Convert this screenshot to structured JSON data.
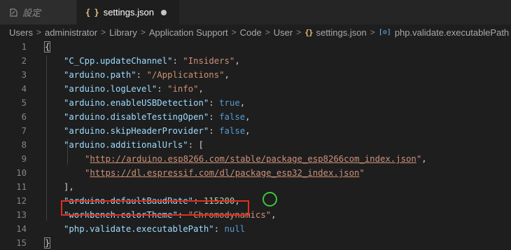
{
  "tabs": [
    {
      "label": "設定",
      "active": false
    },
    {
      "label": "settings.json",
      "active": true,
      "dirty": true
    }
  ],
  "breadcrumb": {
    "segments": [
      "Users",
      "administrator",
      "Library",
      "Application Support",
      "Code",
      "User"
    ],
    "file": "settings.json",
    "symbol": "php.validate.executablePath",
    "file_icon": "{}",
    "symbol_icon": "[⊙]"
  },
  "editor": {
    "line_numbers": [
      "1",
      "2",
      "3",
      "4",
      "5",
      "6",
      "7",
      "8",
      "9",
      "10",
      "11",
      "12",
      "13",
      "14",
      "15"
    ],
    "tokens": {
      "l1_open": "{",
      "l2_key": "\"C_Cpp.updateChannel\"",
      "l2_colon": ": ",
      "l2_val": "\"Insiders\"",
      "l2_comma": ",",
      "l3_key": "\"arduino.path\"",
      "l3_colon": ": ",
      "l3_val": "\"/Applications\"",
      "l3_comma": ",",
      "l4_key": "\"arduino.logLevel\"",
      "l4_colon": ": ",
      "l4_val": "\"info\"",
      "l4_comma": ",",
      "l5_key": "\"arduino.enableUSBDetection\"",
      "l5_colon": ": ",
      "l5_val": "true",
      "l5_comma": ",",
      "l6_key": "\"arduino.disableTestingOpen\"",
      "l6_colon": ": ",
      "l6_val": "false",
      "l6_comma": ",",
      "l7_key": "\"arduino.skipHeaderProvider\"",
      "l7_colon": ": ",
      "l7_val": "false",
      "l7_comma": ",",
      "l8_key": "\"arduino.additionalUrls\"",
      "l8_colon": ": ",
      "l8_open": "[",
      "l9_q1": "\"",
      "l9_url": "http://arduino.esp8266.com/stable/package_esp8266com_index.json",
      "l9_q2": "\"",
      "l9_comma": ",",
      "l10_q1": "\"",
      "l10_url": "https://dl.espressif.com/dl/package_esp32_index.json",
      "l10_q2": "\"",
      "l11_close": "],",
      "l12_key": "\"arduino.defaultBaudRate\"",
      "l12_colon": ": ",
      "l12_val": "115200",
      "l12_comma": ",",
      "l13_key": "\"workbench.colorTheme\"",
      "l13_colon": ": ",
      "l13_val": "\"Chromodynamics\"",
      "l13_comma": ",",
      "l14_key": "\"php.validate.executablePath\"",
      "l14_colon": ": ",
      "l14_val": "null",
      "l15_close": "}"
    }
  },
  "colors": {
    "annotation_box": "#e0301e",
    "annotation_circle": "#3cc83c",
    "key": "#9cdcfe",
    "string": "#ce9178",
    "keyword": "#569cd6",
    "number": "#b5cea8"
  }
}
